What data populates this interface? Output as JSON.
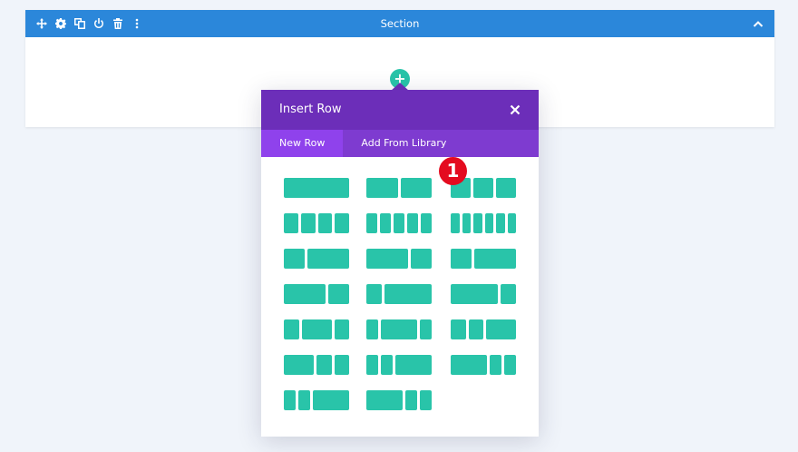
{
  "section": {
    "title": "Section",
    "tools": [
      "move-icon",
      "gear-icon",
      "duplicate-icon",
      "power-icon",
      "trash-icon",
      "more-vertical-icon"
    ],
    "collapse_icon": "chevron-up-icon",
    "bar_color": "#2b87da"
  },
  "add_button": {
    "label": "+"
  },
  "modal": {
    "title": "Insert Row",
    "close_icon": "close-icon",
    "header_color": "#6c2eb9",
    "tabs": [
      {
        "label": "New Row",
        "active": true
      },
      {
        "label": "Add From Library",
        "active": false
      }
    ],
    "layout_color": "#29c4a9",
    "layouts": [
      [
        1
      ],
      [
        1,
        1
      ],
      [
        1,
        1,
        1
      ],
      [
        1,
        1,
        1,
        1
      ],
      [
        1,
        1,
        1,
        1,
        1
      ],
      [
        1,
        1,
        1,
        1,
        1,
        1
      ],
      [
        1,
        2
      ],
      [
        2,
        1
      ],
      [
        1,
        2
      ],
      [
        2,
        1
      ],
      [
        1,
        3
      ],
      [
        3,
        1
      ],
      [
        1,
        2,
        1
      ],
      [
        1,
        3,
        1
      ],
      [
        1,
        1,
        2
      ],
      [
        2,
        1,
        1
      ],
      [
        1,
        1,
        3
      ],
      [
        3,
        1,
        1
      ],
      [
        1,
        1,
        3
      ],
      [
        3,
        1,
        1
      ]
    ]
  },
  "badge": {
    "label": "1",
    "color": "#e40b1f"
  }
}
